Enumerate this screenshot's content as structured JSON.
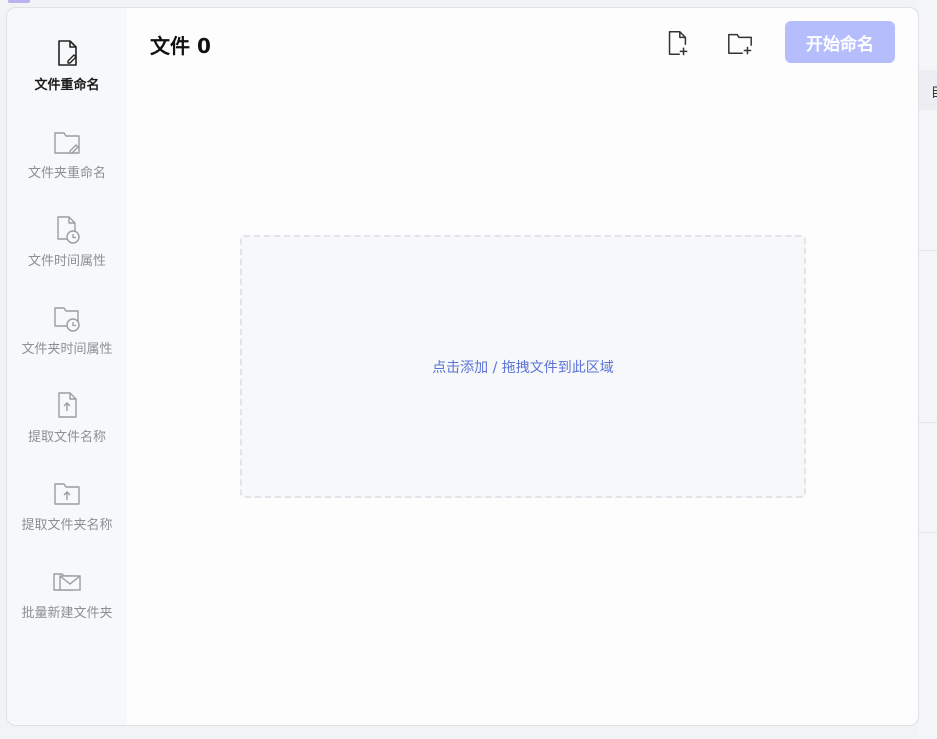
{
  "sidebar": {
    "items": [
      {
        "label": "文件重命名",
        "icon": "file-edit-icon",
        "active": true
      },
      {
        "label": "文件夹重命名",
        "icon": "folder-edit-icon",
        "active": false
      },
      {
        "label": "文件时间属性",
        "icon": "file-clock-icon",
        "active": false
      },
      {
        "label": "文件夹时间属性",
        "icon": "folder-clock-icon",
        "active": false
      },
      {
        "label": "提取文件名称",
        "icon": "file-upload-icon",
        "active": false
      },
      {
        "label": "提取文件夹名称",
        "icon": "folder-upload-icon",
        "active": false
      },
      {
        "label": "批量新建文件夹",
        "icon": "folder-mail-icon",
        "active": false
      }
    ]
  },
  "header": {
    "title": "文件 0",
    "add_file_icon": "file-plus-icon",
    "add_folder_icon": "folder-plus-icon",
    "start_label": "开始命名"
  },
  "dropzone": {
    "text": "点击添加 / 拖拽文件到此区域"
  },
  "background": {
    "column_header_partial": "目"
  },
  "colors": {
    "accent": "#b6bdfd",
    "link": "#5b73d6",
    "sidebar_bg": "#f7f8fa"
  }
}
